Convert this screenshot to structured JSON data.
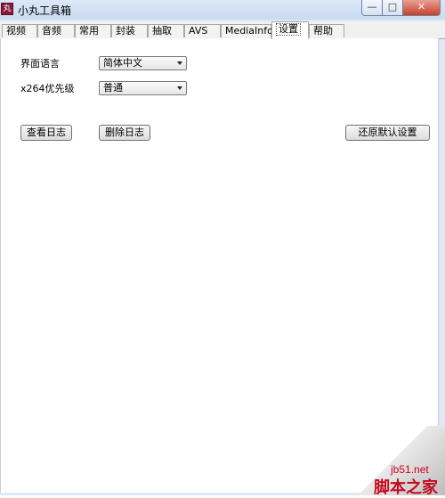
{
  "window": {
    "title": "小丸工具箱",
    "app_icon_glyph": "丸",
    "min_glyph": "—",
    "max_glyph": "□",
    "close_glyph": "✕"
  },
  "tabs": [
    {
      "label": "视频",
      "active": false
    },
    {
      "label": "音频",
      "active": false
    },
    {
      "label": "常用",
      "active": false
    },
    {
      "label": "封装",
      "active": false
    },
    {
      "label": "抽取",
      "active": false
    },
    {
      "label": "AVS",
      "active": false
    },
    {
      "label": "MediaInfo",
      "active": false
    },
    {
      "label": "设置",
      "active": true
    },
    {
      "label": "帮助",
      "active": false
    }
  ],
  "settings": {
    "ui_language_label": "界面语言",
    "ui_language_value": "简体中文",
    "x264_priority_label": "x264优先级",
    "x264_priority_value": "普通",
    "view_log_button": "查看日志",
    "delete_log_button": "删除日志",
    "restore_defaults_button": "还原默认设置"
  },
  "watermark": {
    "site": "jb51.net",
    "brand": "脚本之家"
  }
}
